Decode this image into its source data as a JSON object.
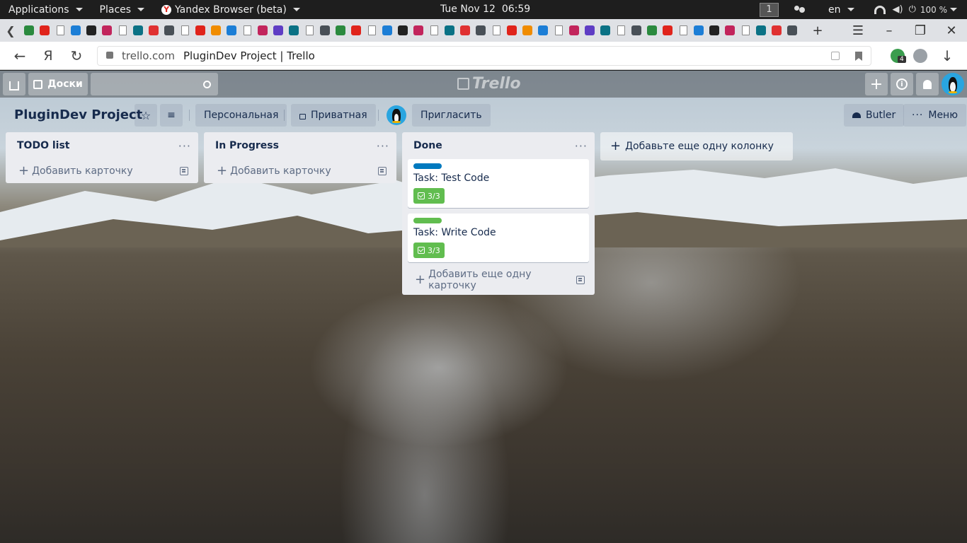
{
  "system_bar": {
    "applications": "Applications",
    "places": "Places",
    "browser_app": "Yandex Browser (beta)",
    "clock": "Tue Nov 12  06:59",
    "workspace": "1",
    "language": "en",
    "battery": "100 %"
  },
  "browser": {
    "tab_count_visible": 50,
    "url_domain": "trello.com",
    "page_title": "PluginDev Project | Trello",
    "extension_badge": "4"
  },
  "trello_header": {
    "boards_label": "Доски",
    "logo_text": "Trello"
  },
  "board": {
    "title": "PluginDev Project",
    "visibility_team": "Персональная",
    "visibility_privacy": "Приватная",
    "invite_label": "Пригласить",
    "butler_label": "Butler",
    "menu_label": "Меню",
    "add_list_label": "Добавьте еще одну колонку"
  },
  "lists": [
    {
      "title": "TODO list",
      "add_label": "Добавить карточку",
      "cards": []
    },
    {
      "title": "In Progress",
      "add_label": "Добавить карточку",
      "cards": []
    },
    {
      "title": "Done",
      "add_label": "Добавить еще одну карточку",
      "cards": [
        {
          "title": "Task: Test Code",
          "label_color": "#0079bf",
          "checklist": "3/3"
        },
        {
          "title": "Task: Write Code",
          "label_color": "#61bd4f",
          "checklist": "3/3"
        }
      ]
    }
  ],
  "colors": {
    "checklist_complete": "#61bd4f",
    "list_bg": "#ebecf0",
    "text": "#172b4d"
  }
}
